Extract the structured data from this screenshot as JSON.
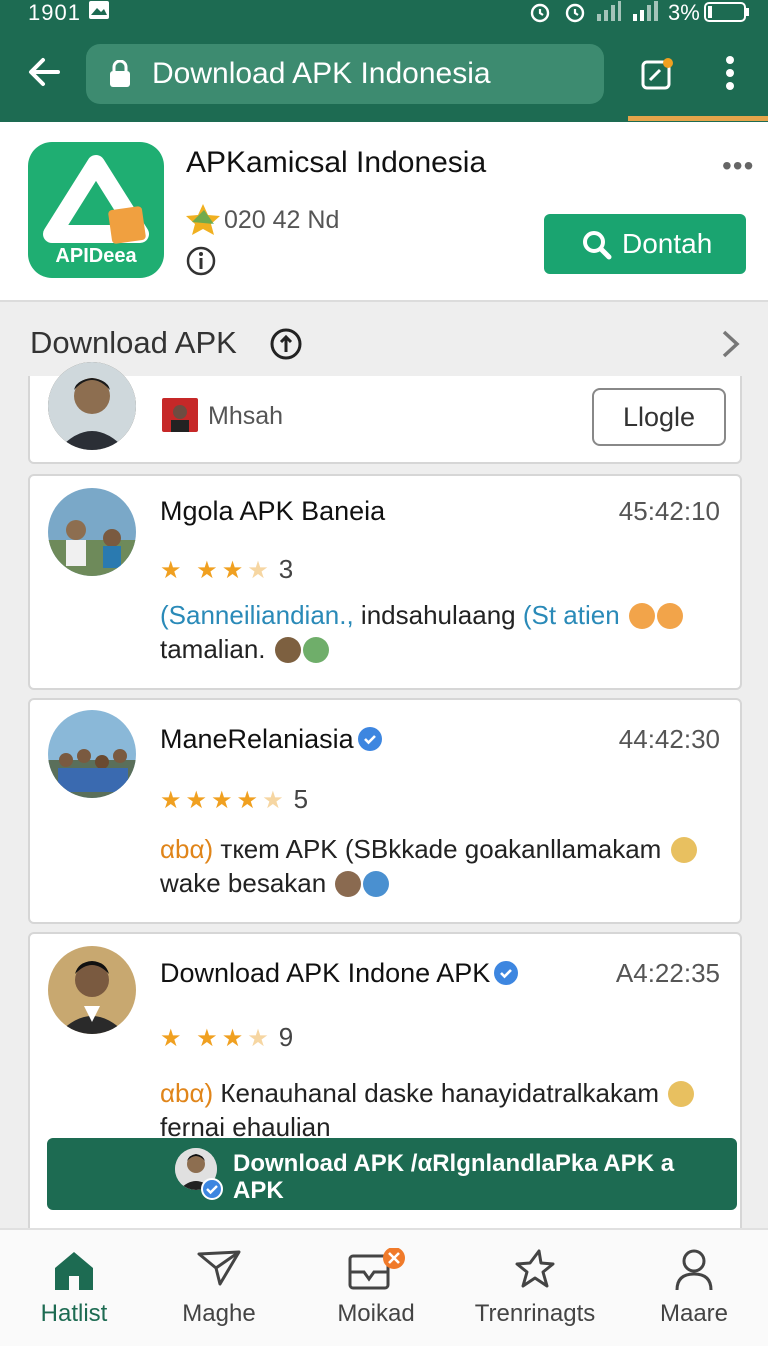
{
  "status_bar": {
    "time": "1901",
    "battery": "3%"
  },
  "browser": {
    "url_text": "Download APK Indonesia"
  },
  "app": {
    "icon_label": "APIDeea",
    "title": "APKamicsal Indonesia",
    "rating_text": "020 42 Nd",
    "action_button": "Dontah"
  },
  "section": {
    "title": "Download APK"
  },
  "top_card": {
    "name": "Mhsah",
    "button": "Llogle"
  },
  "reviews": [
    {
      "name": "Mgola APK Baneia",
      "time": "45:42:10",
      "stars": 3,
      "count": "3",
      "text_highlight": "(Sanneiliandian.,",
      "text_mid": " indsahulaang ",
      "text_highlight2": "(St atien",
      "text_tail": "tamalian."
    },
    {
      "name": "ManeRelaniasia",
      "time": "44:42:30",
      "stars": 4,
      "count": "5",
      "text_prefix": "αbα)",
      "text_main": " ткem APK (SBkkade goakanllamakam",
      "text_tail": "wake besakan"
    },
    {
      "name": "Download APK Indone APK",
      "time": "A4:22:35",
      "stars": 3,
      "count": "9",
      "text_prefix": "αbα)",
      "text_main": " Кenauhanal daske hanayidatralkakam",
      "text_tail": "fernai ehaulian"
    }
  ],
  "download_banner": {
    "text": "Download APK /αRlgnlandlaPka APK a APK"
  },
  "bottom_nav": [
    {
      "label": "Hatlist",
      "icon": "home-icon",
      "active": true
    },
    {
      "label": "Maghe",
      "icon": "send-icon",
      "active": false
    },
    {
      "label": "Moikad",
      "icon": "inbox-icon",
      "active": false,
      "badge": "×"
    },
    {
      "label": "Trenrinagts",
      "icon": "star-icon",
      "active": false
    },
    {
      "label": "Maare",
      "icon": "person-icon",
      "active": false
    }
  ],
  "colors": {
    "primary": "#1d6b52",
    "accent": "#1aa470",
    "star": "#f0a020",
    "badge": "#f07a2a"
  }
}
